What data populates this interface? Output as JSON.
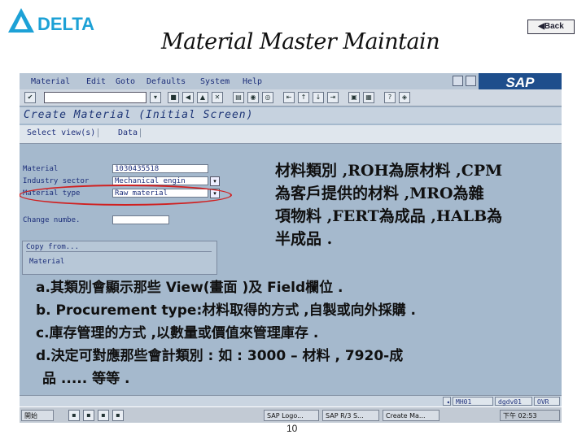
{
  "logo": {
    "text": "DELTA",
    "color": "#1da1d6"
  },
  "slide": {
    "title": "Material Master Maintain",
    "back_label": "Back",
    "page_number": "10"
  },
  "sap": {
    "menu": [
      "Material",
      "Edit",
      "Goto",
      "Defaults",
      "System",
      "Help"
    ],
    "brand": "SAP",
    "command_value": "",
    "screen_title": "Create Material (Initial Screen)",
    "app_buttons": [
      "Select view(s)",
      "Data"
    ],
    "fields": {
      "material_label": "Material",
      "material_value": "1030435518",
      "industry_label": "Industry sector",
      "industry_value": "Mechanical engin",
      "type_label": "Material type",
      "type_value": "Raw material",
      "change_label": "Change numbe."
    },
    "copy_from": {
      "label": "Copy from...",
      "material_label": "Material"
    },
    "status": [
      "MH01",
      "dgdv01",
      "OVR"
    ],
    "taskbar": [
      "開始",
      "SAP Logo...",
      "SAP R/3 S...",
      "Create Ma..."
    ],
    "clock": "下午 02:53",
    "colors": {
      "window": "#a5b9cd",
      "text": "#1d2f7a",
      "highlight": "#d02020"
    }
  },
  "notes": {
    "callout": [
      "材料類別 ,ROH為原材料 ,CPM",
      "為客戶提供的材料 ,MRO為雜",
      "項物料 ,FERT為成品 ,HALB為",
      "半成品 ."
    ],
    "list": [
      "a.其類別會顯示那些 View(畫面 )及 Field欄位 .",
      "b. Procurement type:材料取得的方式 ,自製或向外採購 .",
      "c.庫存管理的方式 ,以數量或價值來管理庫存 .",
      "d.決定可對應那些會計類別 : 如 : 3000 – 材料 , 7920-成",
      "品 ..... 等等 ."
    ]
  }
}
